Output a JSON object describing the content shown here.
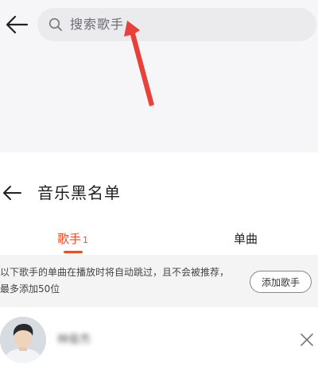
{
  "search_screen": {
    "back_icon": "arrow-left-icon",
    "search": {
      "icon": "search-icon",
      "placeholder": "搜索歌手"
    }
  },
  "blacklist_screen": {
    "back_icon": "arrow-left-icon",
    "title": "音乐黑名单",
    "tabs": [
      {
        "label": "歌手",
        "count": "1",
        "active": true
      },
      {
        "label": "单曲",
        "active": false
      }
    ],
    "info": {
      "text": "以下歌手的单曲在播放时将自动跳过，且不会被推荐，最多添加50位",
      "add_button": "添加歌手"
    },
    "singers": [
      {
        "name": "林俊杰",
        "remove_icon": "close-icon"
      }
    ]
  },
  "colors": {
    "accent": "#e84e2c",
    "annotation_arrow": "#e8413b"
  }
}
